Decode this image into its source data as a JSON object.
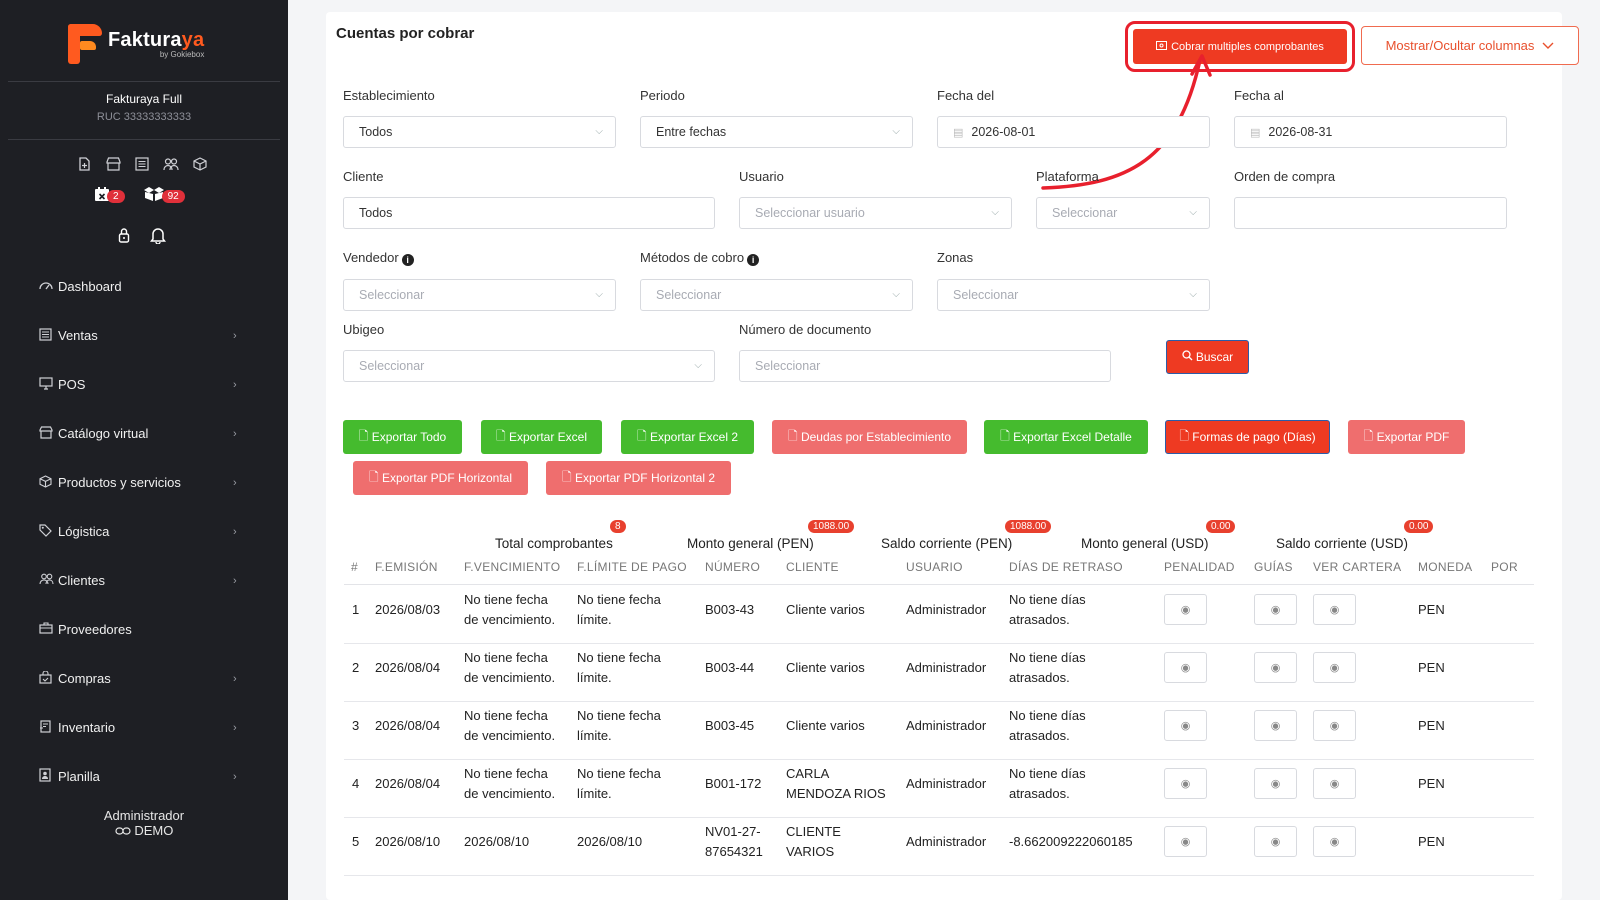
{
  "sidebar": {
    "logo": {
      "name_main": "Faktura",
      "name_accent": "ya",
      "by": "by Gokiebox"
    },
    "company": {
      "name": "Fakturaya Full",
      "ruc": "RUC 33333333333"
    },
    "badges": [
      {
        "icon": "calendar-x-icon",
        "count": "2"
      },
      {
        "icon": "boxes-icon",
        "count": "92"
      }
    ],
    "menu": [
      {
        "label": "Dashboard",
        "icon": "dashboard-icon",
        "has_children": false
      },
      {
        "label": "Ventas",
        "icon": "ventas-icon",
        "has_children": true
      },
      {
        "label": "POS",
        "icon": "pos-icon",
        "has_children": true
      },
      {
        "label": "Catálogo virtual",
        "icon": "store-icon",
        "has_children": true
      },
      {
        "label": "Productos y servicios",
        "icon": "box-icon",
        "has_children": true
      },
      {
        "label": "Lógistica",
        "icon": "tag-icon",
        "has_children": true
      },
      {
        "label": "Clientes",
        "icon": "users-icon",
        "has_children": true
      },
      {
        "label": "Proveedores",
        "icon": "briefcase-icon",
        "has_children": false
      },
      {
        "label": "Compras",
        "icon": "bag-icon",
        "has_children": true
      },
      {
        "label": "Inventario",
        "icon": "inventory-icon",
        "has_children": true
      },
      {
        "label": "Planilla",
        "icon": "badge-icon",
        "has_children": true
      }
    ],
    "user": {
      "name": "Administrador",
      "mode": "DEMO"
    }
  },
  "header": {
    "title": "Cuentas por cobrar",
    "multi_button": "Cobrar multiples comprobantes",
    "columns_button": "Mostrar/Ocultar columnas"
  },
  "filters": {
    "establecimiento": {
      "label": "Establecimiento",
      "value": "Todos"
    },
    "periodo": {
      "label": "Periodo",
      "value": "Entre fechas"
    },
    "fecha_del": {
      "label": "Fecha del",
      "value": "2026-08-01"
    },
    "fecha_al": {
      "label": "Fecha al",
      "value": "2026-08-31"
    },
    "cliente": {
      "label": "Cliente",
      "value": "Todos"
    },
    "usuario": {
      "label": "Usuario",
      "placeholder": "Seleccionar usuario"
    },
    "plataforma": {
      "label": "Plataforma",
      "placeholder": "Seleccionar"
    },
    "orden_compra": {
      "label": "Orden de compra",
      "value": ""
    },
    "vendedor": {
      "label": "Vendedor",
      "placeholder": "Seleccionar"
    },
    "metodos_cobro": {
      "label": "Métodos de cobro",
      "placeholder": "Seleccionar"
    },
    "zonas": {
      "label": "Zonas",
      "placeholder": "Seleccionar"
    },
    "ubigeo": {
      "label": "Ubigeo",
      "placeholder": "Seleccionar"
    },
    "numero_documento": {
      "label": "Número de documento",
      "placeholder": "Seleccionar"
    },
    "buscar": "Buscar"
  },
  "export_buttons": [
    {
      "label": "Exportar Todo"
    },
    {
      "label": "Exportar Excel"
    },
    {
      "label": "Exportar Excel 2"
    },
    {
      "label": "Deudas por Establecimiento"
    },
    {
      "label": "Exportar Excel Detalle"
    },
    {
      "label": "Formas de pago (Días)"
    },
    {
      "label": "Exportar PDF"
    },
    {
      "label": "Exportar PDF Horizontal"
    },
    {
      "label": "Exportar PDF Horizontal 2"
    }
  ],
  "summary": {
    "total_comprobantes": {
      "label": "Total comprobantes",
      "value": "8"
    },
    "monto_general_pen": {
      "label": "Monto general (PEN)",
      "value": "1088.00"
    },
    "saldo_corriente_pen": {
      "label": "Saldo corriente (PEN)",
      "value": "1088.00"
    },
    "monto_general_usd": {
      "label": "Monto general (USD)",
      "value": "0.00"
    },
    "saldo_corriente_usd": {
      "label": "Saldo corriente (USD)",
      "value": "0.00"
    }
  },
  "table": {
    "headers": [
      "#",
      "F.EMISIÓN",
      "F.VENCIMIENTO",
      "F.LÍMITE DE PAGO",
      "NÚMERO",
      "CLIENTE",
      "USUARIO",
      "DÍAS DE RETRASO",
      "PENALIDAD",
      "GUÍAS",
      "VER CARTERA",
      "MONEDA",
      "POR"
    ],
    "rows": [
      {
        "n": "1",
        "emision": "2026/08/03",
        "venc1": "No tiene fecha",
        "venc2": "de vencimiento.",
        "lim1": "No tiene fecha",
        "lim2": "límite.",
        "num1": "B003-43",
        "num2": "",
        "cli1": "Cliente varios",
        "cli2": "",
        "usuario": "Administrador",
        "ret1": "No tiene días",
        "ret2": "atrasados.",
        "moneda": "PEN"
      },
      {
        "n": "2",
        "emision": "2026/08/04",
        "venc1": "No tiene fecha",
        "venc2": "de vencimiento.",
        "lim1": "No tiene fecha",
        "lim2": "límite.",
        "num1": "B003-44",
        "num2": "",
        "cli1": "Cliente varios",
        "cli2": "",
        "usuario": "Administrador",
        "ret1": "No tiene días",
        "ret2": "atrasados.",
        "moneda": "PEN"
      },
      {
        "n": "3",
        "emision": "2026/08/04",
        "venc1": "No tiene fecha",
        "venc2": "de vencimiento.",
        "lim1": "No tiene fecha",
        "lim2": "límite.",
        "num1": "B003-45",
        "num2": "",
        "cli1": "Cliente varios",
        "cli2": "",
        "usuario": "Administrador",
        "ret1": "No tiene días",
        "ret2": "atrasados.",
        "moneda": "PEN"
      },
      {
        "n": "4",
        "emision": "2026/08/04",
        "venc1": "No tiene fecha",
        "venc2": "de vencimiento.",
        "lim1": "No tiene fecha",
        "lim2": "límite.",
        "num1": "B001-172",
        "num2": "",
        "cli1": "CARLA",
        "cli2": "MENDOZA RIOS",
        "usuario": "Administrador",
        "ret1": "No tiene días",
        "ret2": "atrasados.",
        "moneda": "PEN"
      },
      {
        "n": "5",
        "emision": "2026/08/10",
        "venc1": "2026/08/10",
        "venc2": "",
        "lim1": "2026/08/10",
        "lim2": "",
        "num1": "NV01-27-",
        "num2": "87654321",
        "cli1": "CLIENTE",
        "cli2": "VARIOS",
        "usuario": "Administrador",
        "ret1": "-8.662009222060185",
        "ret2": "",
        "moneda": "PEN"
      }
    ]
  },
  "colors": {
    "sidebar_bg": "#1e1f24",
    "accent": "#ee3a22",
    "export_green": "#45bb2e",
    "export_pink": "#ef6e6e",
    "highlight_red": "#e8202d"
  }
}
